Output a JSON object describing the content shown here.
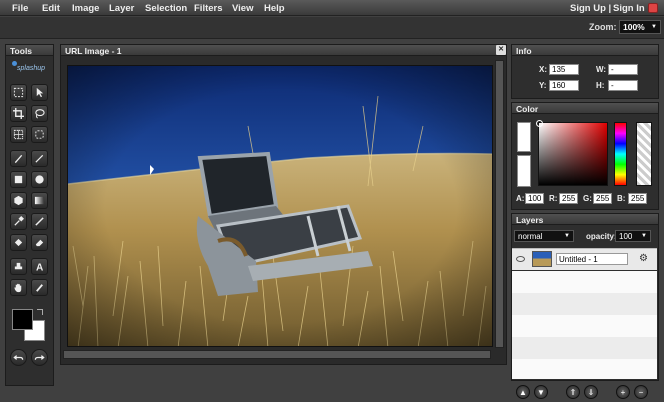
{
  "menu": {
    "file": "File",
    "edit": "Edit",
    "image": "Image",
    "layer": "Layer",
    "selection": "Selection",
    "filters": "Filters",
    "view": "View",
    "help": "Help",
    "signup": "Sign Up |",
    "signin": "Sign In"
  },
  "zoom": {
    "label": "Zoom:",
    "value": "100%"
  },
  "tools": {
    "title": "Tools",
    "brand": "splashup"
  },
  "document": {
    "title": "URL Image - 1",
    "close": "✕"
  },
  "info": {
    "title": "Info",
    "x_label": "X:",
    "x_value": "135",
    "y_label": "Y:",
    "y_value": "160",
    "w_label": "W:",
    "w_value": "-",
    "h_label": "H:",
    "h_value": "-"
  },
  "color": {
    "title": "Color",
    "a_label": "A:",
    "a_value": "100",
    "r_label": "R:",
    "r_value": "255",
    "g_label": "G:",
    "g_value": "255",
    "b_label": "B:",
    "b_value": "255"
  },
  "layers": {
    "title": "Layers",
    "blend_mode": "normal",
    "opacity_label": "opacity:",
    "opacity_value": "100",
    "items": [
      {
        "name": "Untitled - 1"
      }
    ]
  },
  "colors": {
    "background": "#404040",
    "panel": "#2e2e2e",
    "sky": "#1c3d8a",
    "field": "#b89a58"
  }
}
